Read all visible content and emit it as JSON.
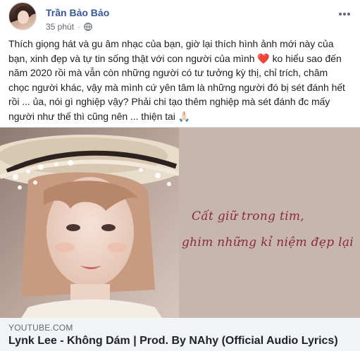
{
  "post": {
    "author": "Trần Bảo Bảo",
    "timestamp": "35 phút",
    "separator": "·",
    "privacy_icon": "globe-icon",
    "more_icon": "more-horizontal-icon",
    "body_lines": [
      "Thích giọng hát và gu âm nhạc của bạn, giờ lại thích hình ảnh mới này của",
      "bạn, xinh đẹp và tự tin sống thật với con người của mình",
      "năm 2020 rồi mà vẫn còn những người có tư tưởng kỳ thị, chỉ trích, châm",
      "chọc người khác, vậy mà mình cứ yên tâm là những người đó bị sét đánh hết",
      "rồi ... ủa, nói gì nghiệp vậy? Phải chi tạo thêm nghiệp mà sét đánh đc mấy",
      "người như thế thì cũng nên ... thiện tai"
    ],
    "line2_after_heart": "ko hiểu sao đến",
    "heart_emoji": "❤️",
    "pray_emoji": "🙏🏻"
  },
  "link_card": {
    "image_lyrics": [
      "Cất giữ trong tim,",
      "ghim những kỉ niệm đẹp lại"
    ],
    "domain": "YOUTUBE.COM",
    "title": "Lynk Lee - Không Dám | Prod. By NAhy (Official Audio Lyrics)"
  },
  "colors": {
    "author_link": "#385898",
    "meta_text": "#616770",
    "body_text": "#1c1e21",
    "card_info_bg": "#f2f3f5",
    "lyric_text": "#8a2a3c",
    "heart": "#e0245e"
  }
}
